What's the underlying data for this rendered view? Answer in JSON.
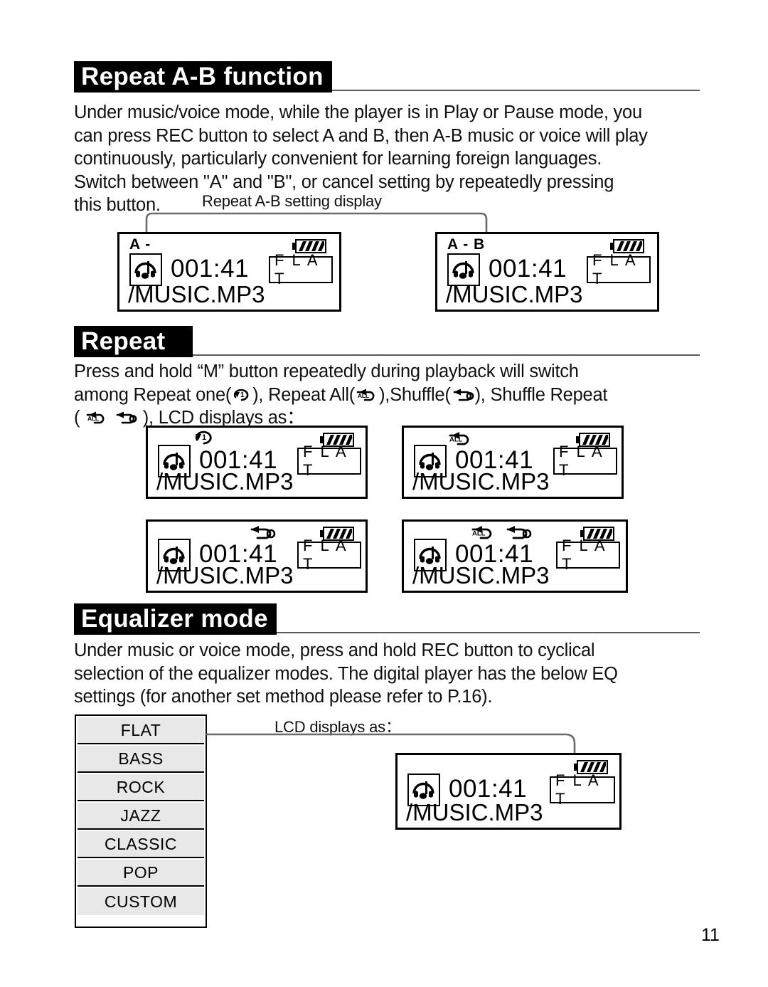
{
  "page": {
    "number": "11"
  },
  "sections": [
    {
      "id": "repeat-ab",
      "title": "Repeat A-B function",
      "body": [
        "Under music/voice mode, while the player is in Play or Pause mode, you",
        "can press REC button to select A and B, then A-B music or voice will play",
        "continuously, particularly convenient for learning foreign languages.",
        "Switch between \"A\" and \"B\", or cancel setting by repeatedly pressing",
        "this button."
      ],
      "connector_label": "Repeat A-B setting display"
    },
    {
      "id": "repeat",
      "title": "Repeat",
      "body_lead": "Press and hold",
      "body_quoted": "“M”",
      "body_mid1": "button repeatedly during playback will switch",
      "body_mid2_a": "among Repeat one(",
      "body_mid2_b": "), Repeat All(",
      "body_mid2_c": "),Shuffle(",
      "body_mid2_d": "), Shuffle Repeat",
      "body_mid3_a": "(",
      "body_mid3_b": "), LCD displays as："
    },
    {
      "id": "equalizer",
      "title": "Equalizer mode",
      "body": [
        "Under music or voice mode, press and hold  REC button to cyclical",
        "selection of the equalizer modes. The digital player has the below EQ",
        "settings (for another set method please refer to P.16)."
      ],
      "connector_label": "LCD displays as："
    }
  ],
  "lcd_common": {
    "time": "001:41",
    "filename": "/MUSIC.MP3",
    "eq": "F L A T",
    "battery": "battery-full"
  },
  "lcd_panels": [
    {
      "id": "ab-a",
      "mode_text": "A -",
      "mode_icon": "none",
      "group": "repeat-ab"
    },
    {
      "id": "ab-ab",
      "mode_text": "A - B",
      "mode_icon": "none",
      "group": "repeat-ab"
    },
    {
      "id": "rep-one",
      "mode_text": "",
      "mode_icon": "repeat-one",
      "group": "repeat"
    },
    {
      "id": "rep-all",
      "mode_text": "",
      "mode_icon": "repeat-all",
      "group": "repeat"
    },
    {
      "id": "shuffle",
      "mode_text": "",
      "mode_icon": "shuffle",
      "group": "repeat"
    },
    {
      "id": "shuf-rep",
      "mode_text": "",
      "mode_icon": "shuffle-repeat",
      "group": "repeat"
    },
    {
      "id": "eq-flat",
      "mode_text": "",
      "mode_icon": "none",
      "group": "equalizer"
    }
  ],
  "eq_settings": [
    "FLAT",
    "BASS",
    "ROCK",
    "JAZZ",
    "CLASSIC",
    "POP",
    "CUSTOM"
  ],
  "colors": {
    "ink": "#000000",
    "paper": "#ffffff",
    "row_fill": "#e8e8e8",
    "rule": "#5a5a5a"
  }
}
